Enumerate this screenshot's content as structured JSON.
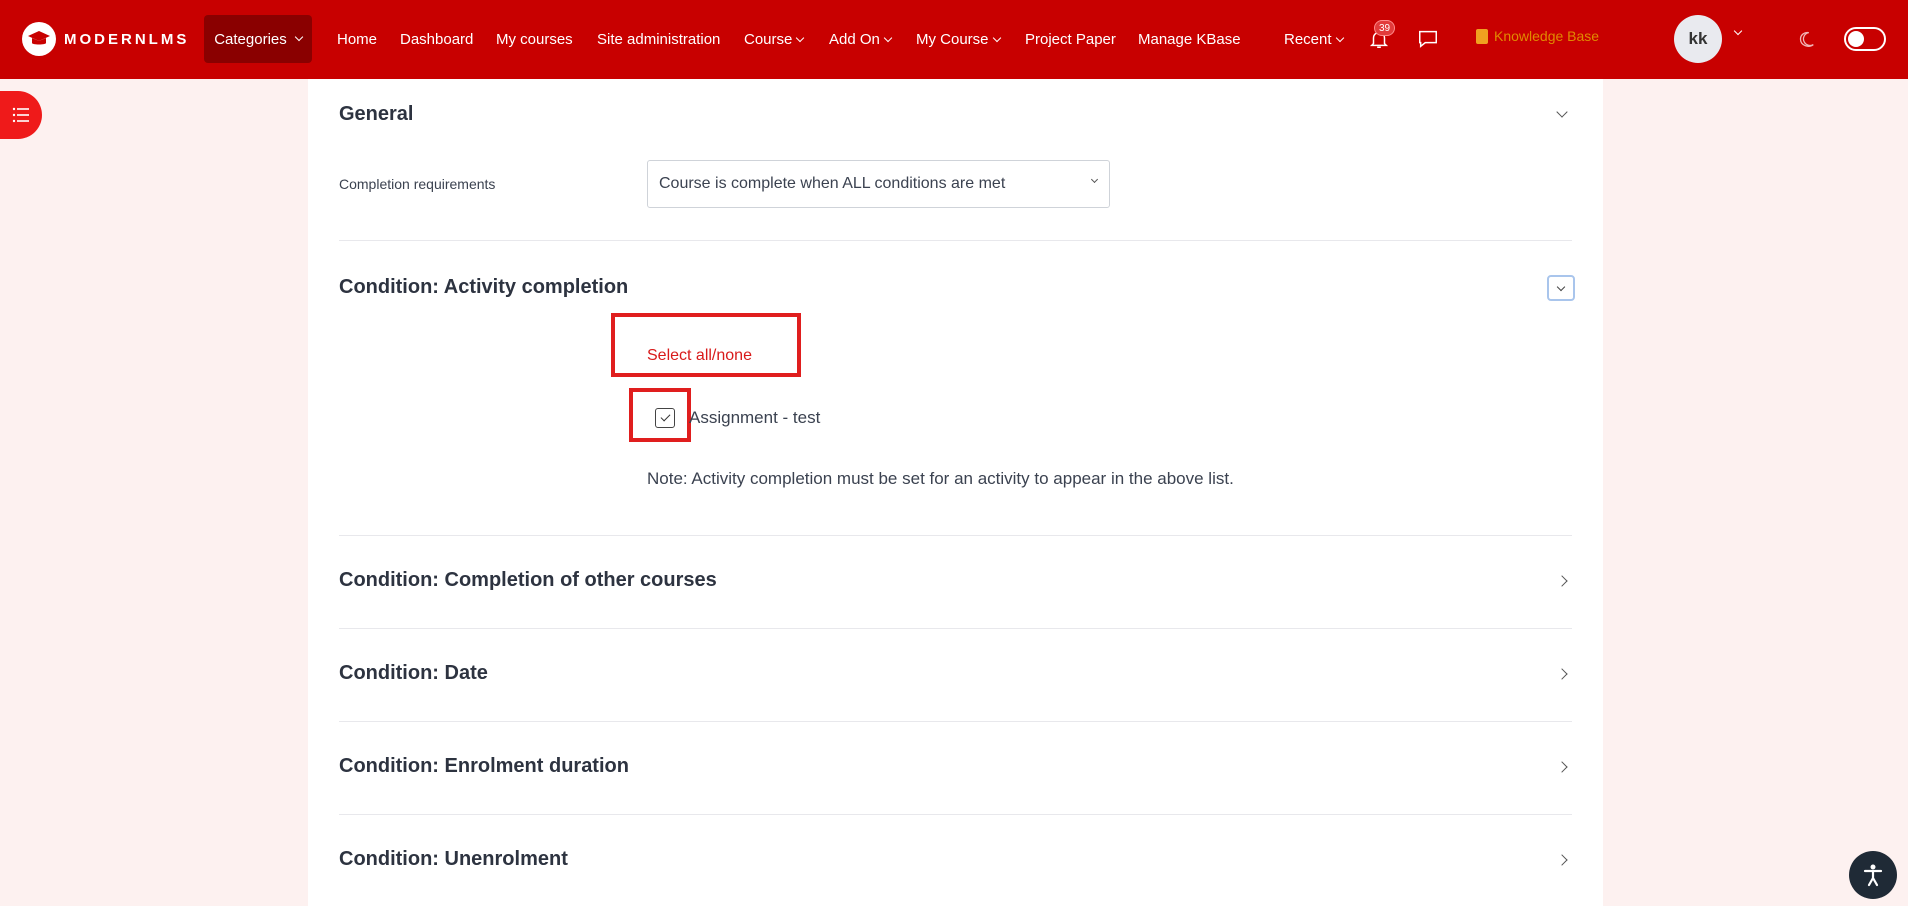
{
  "navbar": {
    "brand": "MODERNLMS",
    "categories_label": "Categories",
    "items": [
      {
        "label": "Home"
      },
      {
        "label": "Dashboard"
      },
      {
        "label": "My courses"
      },
      {
        "label": "Site administration"
      },
      {
        "label": "Course"
      },
      {
        "label": "Add On"
      },
      {
        "label": "My Course"
      },
      {
        "label": "Project Paper"
      },
      {
        "label": "Manage KBase"
      },
      {
        "label": "Recent"
      }
    ],
    "notification_count": "39",
    "knowledge_base_label": "Knowledge Base",
    "avatar_initials": "kk",
    "brand_color": "#c80000"
  },
  "form": {
    "general": {
      "heading": "General",
      "completion_requirements_label": "Completion requirements",
      "completion_requirements_value": "Course is complete when ALL conditions are met"
    },
    "activity_completion": {
      "heading": "Condition: Activity completion",
      "select_all_label": "Select all/none",
      "activities": [
        {
          "label": "Assignment - test",
          "checked": true
        }
      ],
      "note": "Note: Activity completion must be set for an activity to appear in the above list."
    },
    "collapsed_sections": [
      {
        "heading": "Condition: Completion of other courses"
      },
      {
        "heading": "Condition: Date"
      },
      {
        "heading": "Condition: Enrolment duration"
      },
      {
        "heading": "Condition: Unenrolment"
      }
    ]
  },
  "icons": {
    "logo": "graduation-cap-icon",
    "drawer": "list-icon",
    "notifications": "bell-icon",
    "messages": "chat-bubble-icon",
    "knowledge_base": "book-icon",
    "theme": "moon-icon",
    "accessibility": "accessibility-icon"
  },
  "highlight_color": "#e01e1e"
}
